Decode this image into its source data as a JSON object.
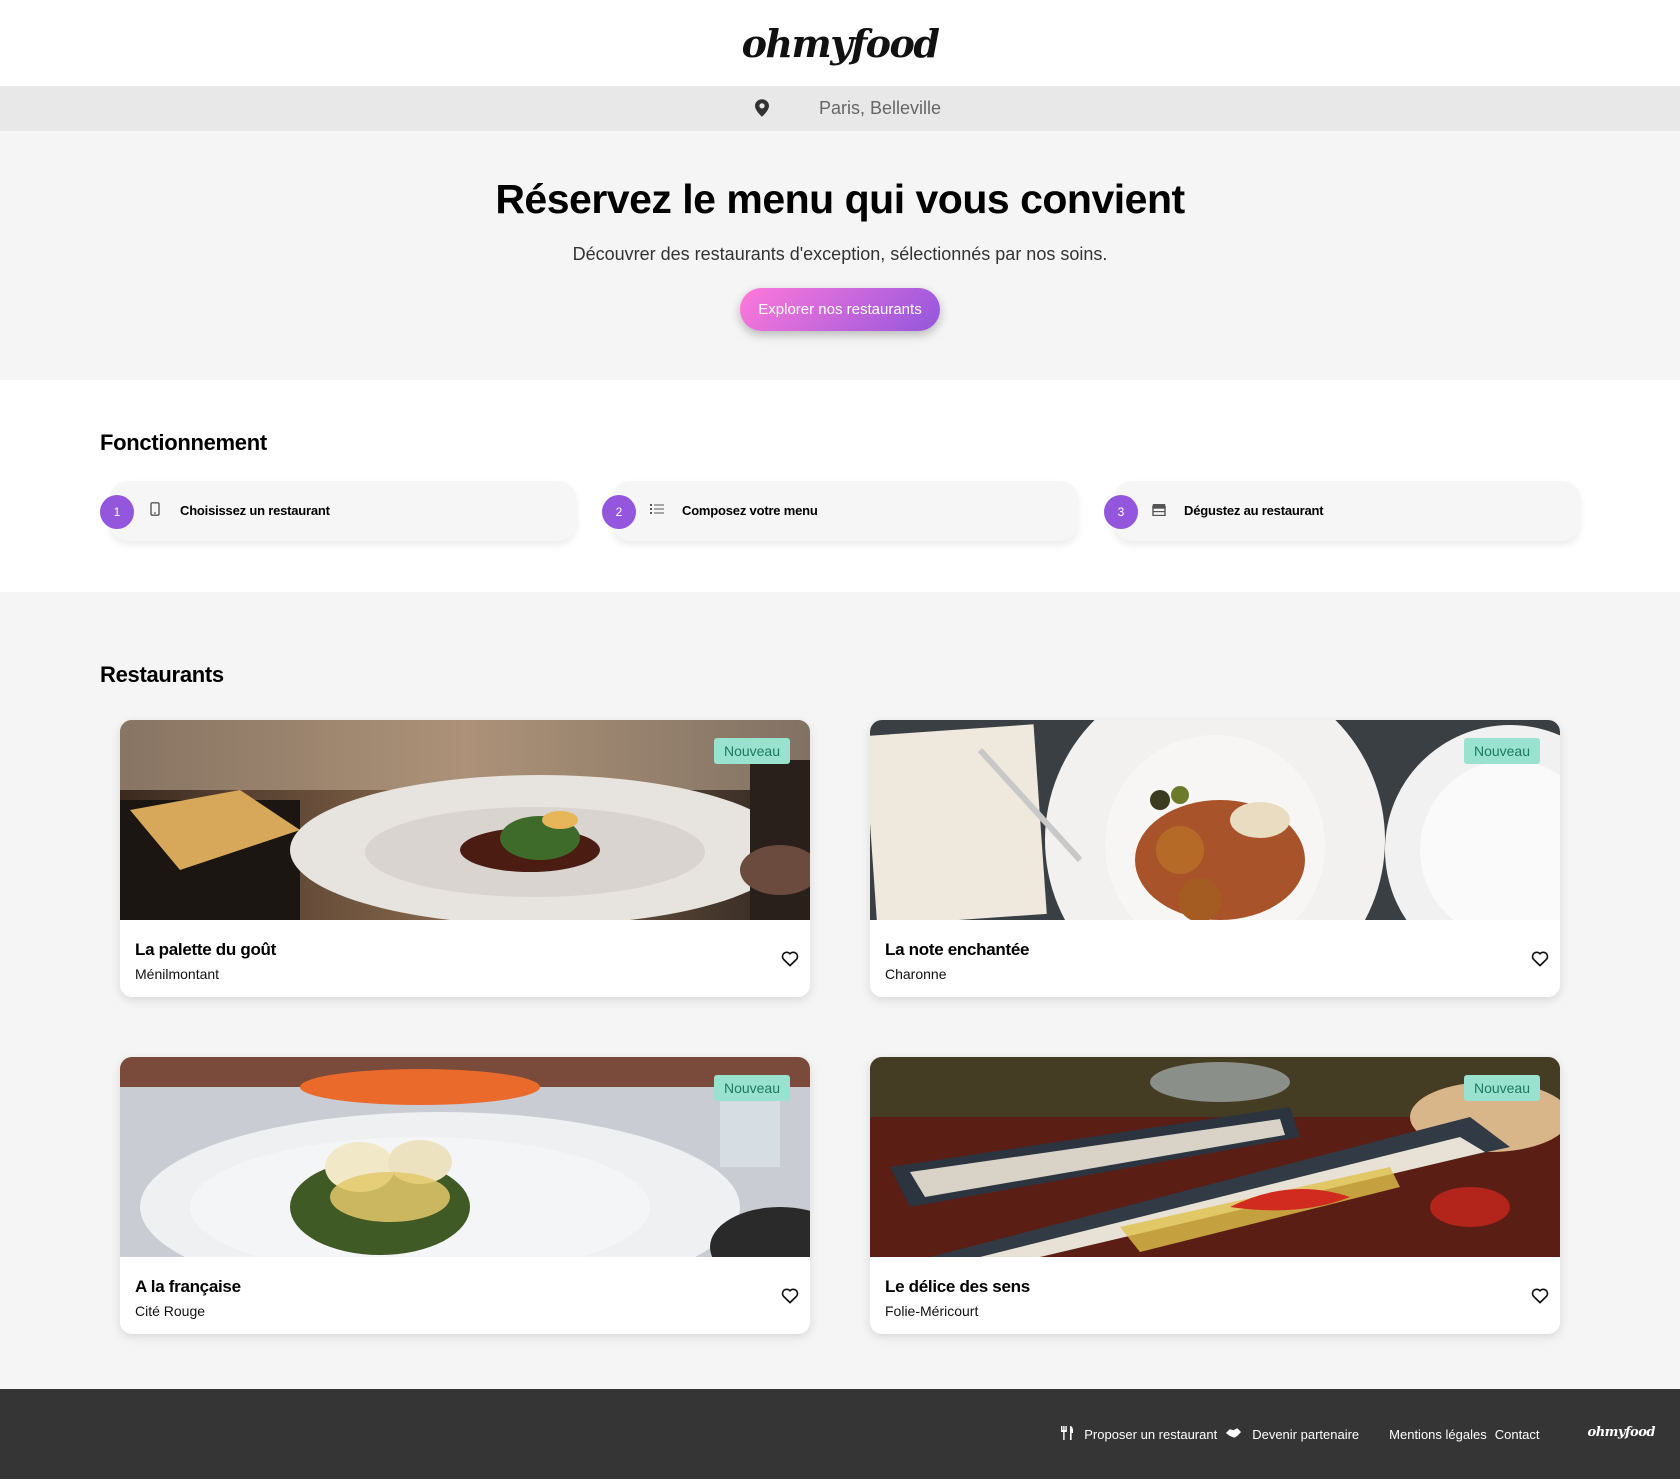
{
  "header": {
    "logo": "ohmyfood"
  },
  "location": {
    "text": "Paris, Belleville",
    "icon": "map-pin-icon"
  },
  "hero": {
    "title": "Réservez le menu qui vous convient",
    "subtitle": "Découvrer des restaurants d'exception, sélectionnés par nos soins.",
    "button_label": "Explorer nos restaurants"
  },
  "how": {
    "title": "Fonctionnement",
    "steps": [
      {
        "number": "1",
        "label": "Choisissez un restaurant",
        "icon": "phone-icon"
      },
      {
        "number": "2",
        "label": "Composez votre menu",
        "icon": "list-icon"
      },
      {
        "number": "3",
        "label": "Dégustez au restaurant",
        "icon": "store-icon"
      }
    ]
  },
  "restaurants": {
    "title": "Restaurants",
    "items": [
      {
        "name": "La palette du goût",
        "district": "Ménilmontant",
        "badge": "Nouveau"
      },
      {
        "name": "La note enchantée",
        "district": "Charonne",
        "badge": "Nouveau"
      },
      {
        "name": "A la française",
        "district": "Cité Rouge",
        "badge": "Nouveau"
      },
      {
        "name": "Le délice des sens",
        "district": "Folie-Méricourt",
        "badge": "Nouveau"
      }
    ]
  },
  "footer": {
    "links": [
      {
        "label": "Proposer un restaurant",
        "icon": "utensils-icon"
      },
      {
        "label": "Devenir partenaire",
        "icon": "handshake-icon"
      },
      {
        "label": "Mentions légales"
      },
      {
        "label": "Contact"
      }
    ],
    "logo": "ohmyfood"
  },
  "colors": {
    "accent": "#9356dc",
    "gradient_start": "#ff79da",
    "badge_bg": "#99e2d0",
    "badge_text": "#1e7a5e",
    "footer_bg": "#353535"
  }
}
